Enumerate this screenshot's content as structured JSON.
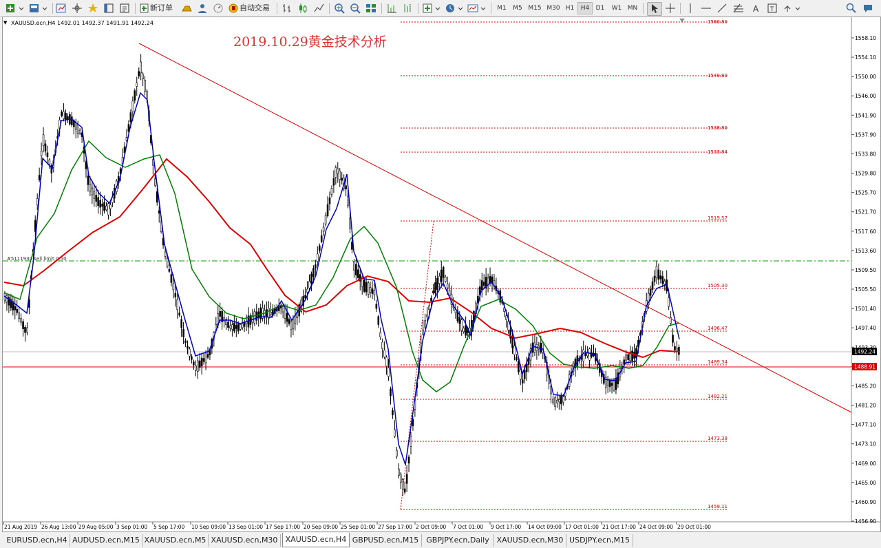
{
  "toolbar": {
    "new_order_label": "新订单",
    "auto_trading_label": "自动交易",
    "timeframes": [
      "M1",
      "M5",
      "M15",
      "M30",
      "H1",
      "H4",
      "D1",
      "W1",
      "MN"
    ],
    "active_timeframe": "H4"
  },
  "chart": {
    "header": "XAUUSD.ecn,H4  1492.01 1492.37 1491.91 1492.24",
    "title": "2019.10.29黄金技术分析",
    "order_label": "#5111930 sell limit 0.50",
    "current_price": "1492.24",
    "red_level_price": "1488.91",
    "y_ticks": [
      "1558.10",
      "1554.10",
      "1550.00",
      "1546.00",
      "1541.90",
      "1537.90",
      "1533.80",
      "1529.80",
      "1525.70",
      "1521.70",
      "1517.60",
      "1513.60",
      "1509.50",
      "1505.50",
      "1501.40",
      "1497.40",
      "1493.30",
      "1489.30",
      "1485.20",
      "1481.20",
      "1477.10",
      "1473.10",
      "1469.00",
      "1465.00",
      "1460.90",
      "1456.90"
    ],
    "fib_levels": [
      "1560.80",
      "1549.80",
      "1538.80",
      "1533.84",
      "1519.57",
      "1505.30",
      "1496.47",
      "1489.34",
      "1482.21",
      "1473.38",
      "1459.11"
    ],
    "x_labels": [
      "21 Aug 2019",
      "26 Aug 13:00",
      "29 Aug 05:00",
      "3 Sep 01:00",
      "5 Sep 17:00",
      "10 Sep 09:00",
      "13 Sep 01:00",
      "17 Sep 17:00",
      "20 Sep 09:00",
      "25 Sep 01:00",
      "27 Sep 17:00",
      "2 Oct 09:00",
      "7 Oct 01:00",
      "9 Oct 17:00",
      "14 Oct 09:00",
      "17 Oct 01:00",
      "21 Oct 17:00",
      "24 Oct 09:00",
      "29 Oct 01:00"
    ],
    "colors": {
      "background": "#ffffff",
      "candles": "#000000",
      "fast_ma": "#0000cc",
      "medium_ma": "#008000",
      "slow_ma": "#e00000",
      "trendline": "#e00000",
      "fib": "#e00000",
      "order_line": "#00a000"
    }
  },
  "tabs": [
    "EURUSD.ecn,H4",
    "AUDUSD.ecn,M15",
    "XAUUSD.ecn,M5",
    "XAUUSD.ecn,M30",
    "XAUUSD.ecn,H4",
    "GBPUSD.ecn,M15",
    "GBPJPY.ecn,Daily",
    "XAUUSD.ecn,M30",
    "USDJPY.ecn,M15"
  ],
  "active_tab": "XAUUSD.ecn,H4"
}
